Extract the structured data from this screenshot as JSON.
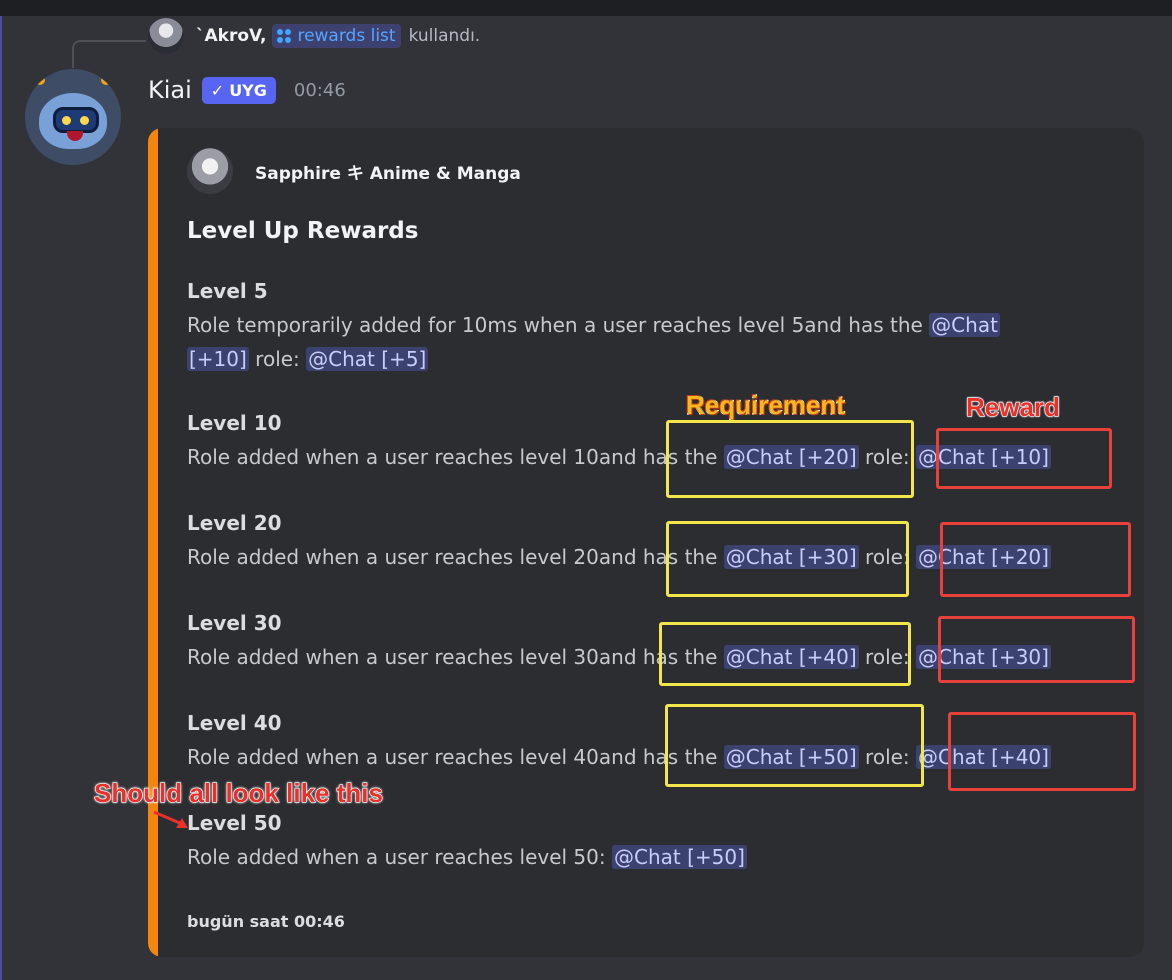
{
  "reply": {
    "user": "`AkroV,",
    "command": "rewards list",
    "action": "kullandı."
  },
  "message": {
    "author": "Kiai",
    "badge": "UYG",
    "badge_check": "✓",
    "timestamp": "00:46"
  },
  "embed": {
    "accent_color": "#f4850d",
    "server_name": "Sapphire キ Anime & Manga",
    "title": "Level Up Rewards",
    "levels": [
      {
        "title": "Level 5",
        "text_pre": "Role temporarily  added for 10ms when a user reaches level 5and has the ",
        "req_role_a": "@Chat",
        "req_role_b": "[+10]",
        "text_mid": " role: ",
        "reward_role": "@Chat [+5]"
      },
      {
        "title": "Level 10",
        "text_pre": "Role  added when a user reaches level 10and has the ",
        "req_role": "@Chat [+20]",
        "text_mid": " role: ",
        "reward_role": "@Chat [+10]"
      },
      {
        "title": "Level 20",
        "text_pre": "Role  added when a user reaches level 20and has the ",
        "req_role": "@Chat [+30]",
        "text_mid": " role: ",
        "reward_role": "@Chat [+20]"
      },
      {
        "title": "Level 30",
        "text_pre": "Role  added when a user reaches level 30and has the ",
        "req_role": "@Chat [+40]",
        "text_mid": " role: ",
        "reward_role": "@Chat [+30]"
      },
      {
        "title": "Level 40",
        "text_pre": "Role  added when a user reaches level 40and has the ",
        "req_role": "@Chat [+50]",
        "text_mid": " role: ",
        "reward_role": "@Chat [+40]"
      },
      {
        "title": "Level 50",
        "text_pre": "Role  added when a user reaches level 50: ",
        "reward_role": "@Chat [+50]"
      }
    ],
    "footer": "bugün saat 00:46"
  },
  "annotations": {
    "requirement": "Requirement",
    "reward": "Reward",
    "should": "Should all look like this",
    "requirement_color": "#f2e64a",
    "reward_color": "#e8403a"
  }
}
